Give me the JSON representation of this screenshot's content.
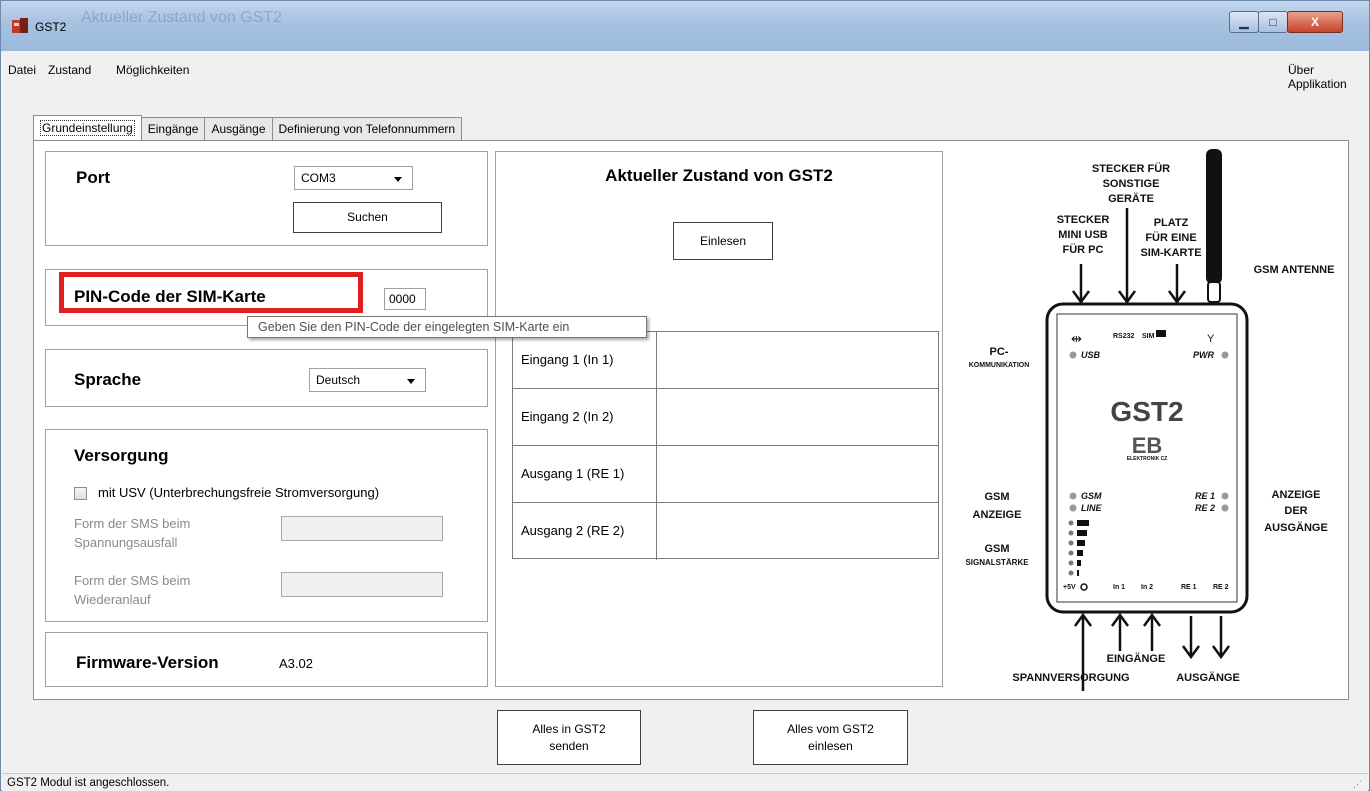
{
  "window": {
    "title": "GST2",
    "background_title": "Aktueller Zustand von GST2",
    "min_glyph": "▁",
    "max_glyph": "□",
    "close_glyph": "X"
  },
  "menu": {
    "items": [
      "Datei",
      "Zustand",
      "Möglichkeiten"
    ],
    "about": "Über Applikation"
  },
  "tabs": [
    {
      "label": "Grundeinstellung",
      "active": true
    },
    {
      "label": "Eingänge",
      "active": false
    },
    {
      "label": "Ausgänge",
      "active": false
    },
    {
      "label": "Definierung von Telefonnummern",
      "active": false
    }
  ],
  "port": {
    "label": "Port",
    "value": "COM3",
    "search_button": "Suchen"
  },
  "pin": {
    "label": "PIN-Code der SIM-Karte",
    "value": "0000",
    "tooltip": "Geben Sie den PIN-Code der eingelegten SIM-Karte ein"
  },
  "language": {
    "label": "Sprache",
    "value": "Deutsch"
  },
  "supply": {
    "label": "Versorgung",
    "ups_checkbox": "mit USV (Unterbrechungsfreie Stromversorgung)",
    "ups_checked": false,
    "sms_outage_label_1": "Form der SMS beim",
    "sms_outage_label_2": "Spannungsausfall",
    "sms_restart_label_1": "Form der SMS beim",
    "sms_restart_label_2": "Wiederanlauf"
  },
  "firmware": {
    "label": "Firmware-Version",
    "value": "A3.02"
  },
  "state": {
    "title": "Aktueller Zustand von GST2",
    "read_button": "Einlesen",
    "rows": [
      {
        "label": "Eingang 1 (In 1)",
        "value": ""
      },
      {
        "label": "Eingang 2 (In 2)",
        "value": ""
      },
      {
        "label": "Ausgang 1 (RE 1)",
        "value": ""
      },
      {
        "label": "Ausgang 2 (RE 2)",
        "value": ""
      }
    ]
  },
  "diagram": {
    "plug_other_1": "STECKER FÜR",
    "plug_other_2": "SONSTIGE",
    "plug_other_3": "GERÄTE",
    "usb_1": "STECKER",
    "usb_2": "MINI USB",
    "usb_3": "FÜR PC",
    "sim_1": "PLATZ",
    "sim_2": "FÜR EINE",
    "sim_3": "SIM-KARTE",
    "antenna": "GSM ANTENNE",
    "pc_1": "PC-",
    "pc_2": "KOMMUNIKATION",
    "gsm_disp_1": "GSM",
    "gsm_disp_2": "ANZEIGE",
    "gsm_sig_1": "GSM",
    "gsm_sig_2": "SIGNALSTÄRKE",
    "out_disp_1": "ANZEIGE",
    "out_disp_2": "DER",
    "out_disp_3": "AUSGÄNGE",
    "inputs": "EINGÄNGE",
    "supply": "SPANNVERSORGUNG",
    "outputs": "AUSGÄNGE",
    "device_name": "GST2",
    "logo": "EB",
    "logo_sub": "ELEKTRONIK CZ",
    "led_usb": "USB",
    "led_pwr": "PWR",
    "led_gsm": "GSM",
    "led_line": "LINE",
    "led_re1": "RE 1",
    "led_re2": "RE 2",
    "port_rs232": "RS232",
    "port_sim": "SIM",
    "term_5v": "+5V",
    "term_in1": "In 1",
    "term_in2": "In 2",
    "term_re1": "RE 1",
    "term_re2": "RE 2"
  },
  "buttons": {
    "send_all_1": "Alles in GST2",
    "send_all_2": "senden",
    "read_all_1": "Alles vom GST2",
    "read_all_2": "einlesen"
  },
  "status": {
    "text": "GST2 Modul ist angeschlossen."
  },
  "colors": {
    "highlight": "#e02020",
    "titlebar": "#a8c3e2",
    "close_button": "#c8432b"
  }
}
